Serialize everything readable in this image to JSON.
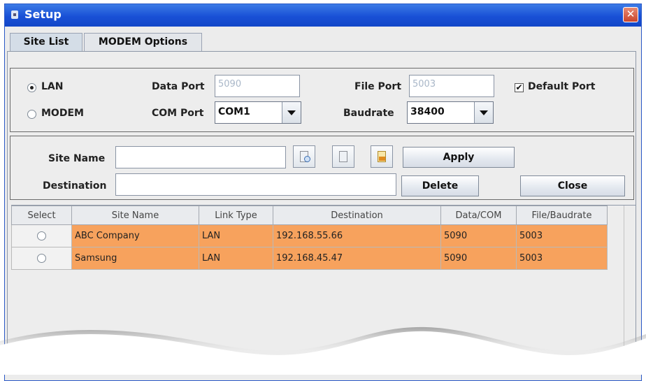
{
  "window": {
    "title": "Setup",
    "close_glyph": "✕"
  },
  "tabs": [
    {
      "label": "Site List",
      "active": true
    },
    {
      "label": "MODEM Options",
      "active": false
    }
  ],
  "connection": {
    "lan_label": "LAN",
    "modem_label": "MODEM",
    "selected": "LAN",
    "data_port_label": "Data Port",
    "data_port_value": "5090",
    "file_port_label": "File Port",
    "file_port_value": "5003",
    "default_port_label": "Default Port",
    "default_port_checked": true,
    "com_port_label": "COM Port",
    "com_port_value": "COM1",
    "baudrate_label": "Baudrate",
    "baudrate_value": "38400"
  },
  "site_form": {
    "site_name_label": "Site Name",
    "destination_label": "Destination",
    "site_name_value": "",
    "destination_value": "",
    "apply_label": "Apply",
    "delete_label": "Delete",
    "close_label": "Close"
  },
  "table": {
    "columns": [
      "Select",
      "Site Name",
      "Link Type",
      "Destination",
      "Data/COM",
      "File/Baudrate"
    ],
    "rows": [
      [
        "",
        "ABC Company",
        "LAN",
        "192.168.55.66",
        "5090",
        "5003"
      ],
      [
        "",
        "Samsung",
        "LAN",
        "192.168.45.47",
        "5090",
        "5003"
      ]
    ]
  },
  "colors": {
    "titlebar": "#1950d6",
    "row_highlight": "#f7a25d",
    "close_button": "#c9452c"
  }
}
